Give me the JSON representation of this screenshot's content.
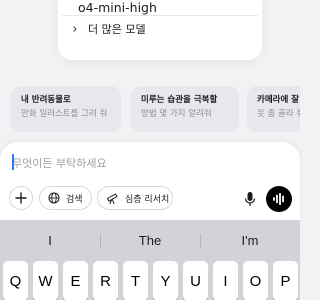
{
  "model_menu": {
    "top_item": "o4-mini-high",
    "more_models_label": "더 많은 모델"
  },
  "suggestions": [
    {
      "title": "내 반려동물로",
      "subtitle": "만화 일러스트를 그려 줘"
    },
    {
      "title": "미루는 습관을 극복할",
      "subtitle": "방법 몇 가지 알려줘"
    },
    {
      "title": "카메라에 잘 받",
      "subtitle": "옷 좀 골라 줘"
    }
  ],
  "composer": {
    "placeholder": "무엇이든 부탁하세요",
    "search_label": "검색",
    "deep_research_label": "심층 리서치"
  },
  "keyboard": {
    "predictions": [
      "I",
      "The",
      "I'm"
    ],
    "row1": [
      "Q",
      "W",
      "E",
      "R",
      "T",
      "Y",
      "U",
      "I",
      "O",
      "P"
    ]
  },
  "icons": {
    "plus": "plus-icon",
    "globe": "globe-icon",
    "telescope": "telescope-icon",
    "mic": "microphone-icon",
    "voice": "voice-waveform-icon",
    "chevron": "chevron-right-icon"
  },
  "colors": {
    "accent_caret": "#2f7cf6",
    "background": "#f2f2f5",
    "keyboard_bg": "#d1d3d9"
  }
}
